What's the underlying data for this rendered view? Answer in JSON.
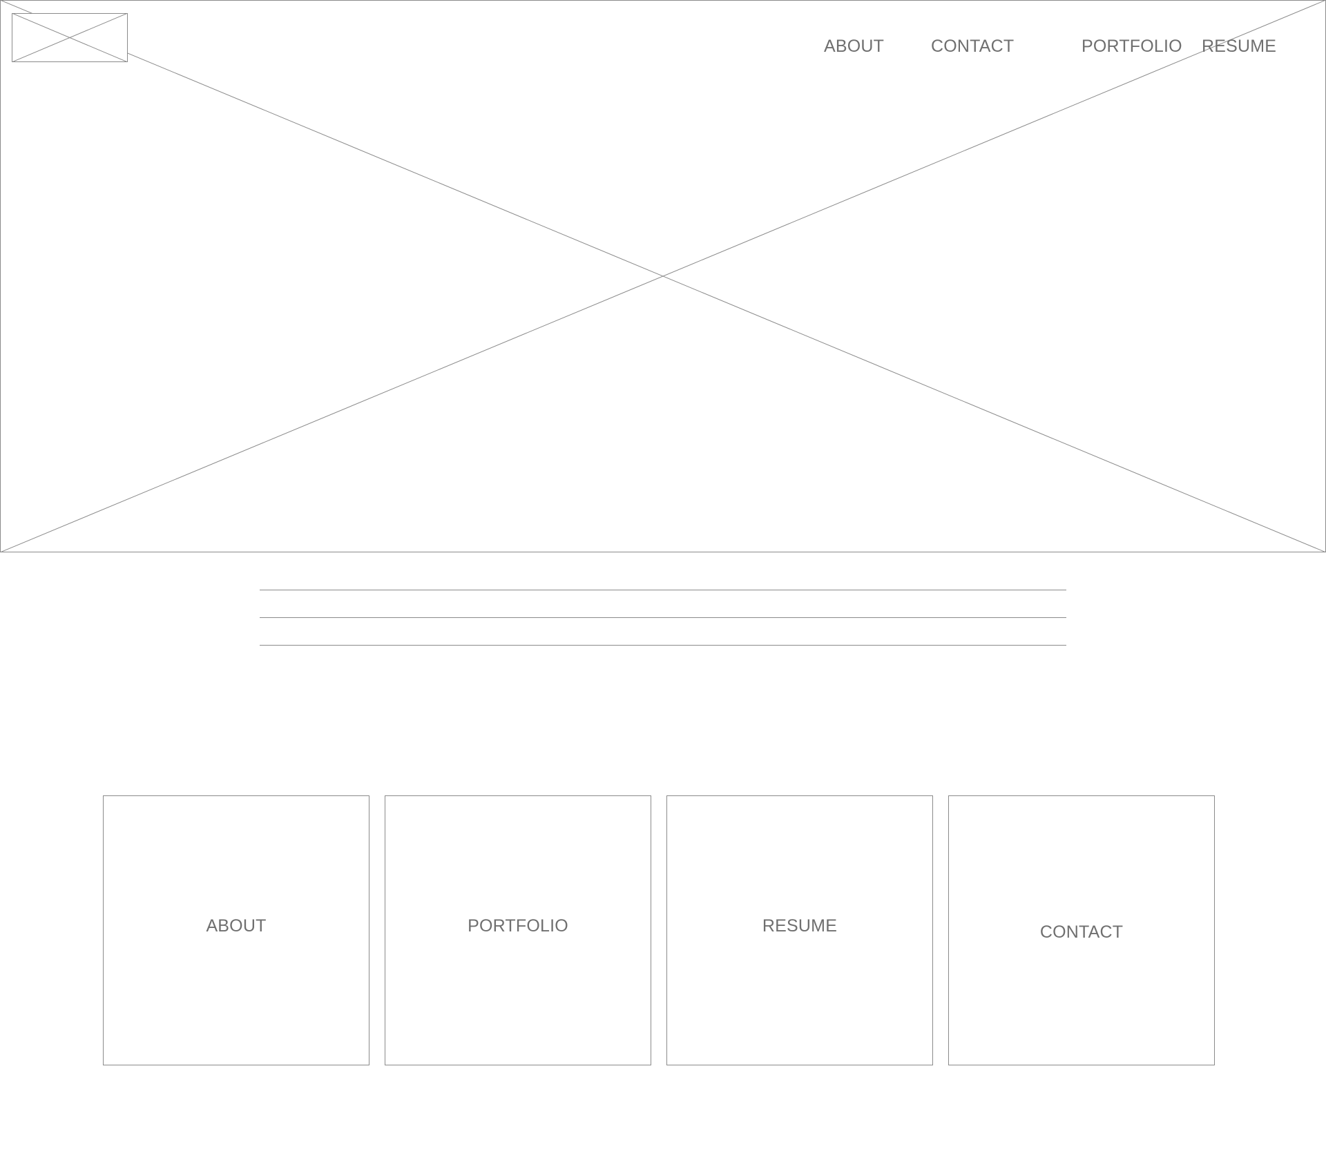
{
  "header": {
    "nav": {
      "about": "ABOUT",
      "contact": "CONTACT",
      "portfolio": "PORTFOLIO",
      "resume": "RESUME"
    }
  },
  "cards": {
    "about": "ABOUT",
    "portfolio": "PORTFOLIO",
    "resume": "RESUME",
    "contact": "CONTACT"
  },
  "colors": {
    "line": "#8a8a8a",
    "text": "#6f6f6f",
    "background": "#ffffff"
  }
}
